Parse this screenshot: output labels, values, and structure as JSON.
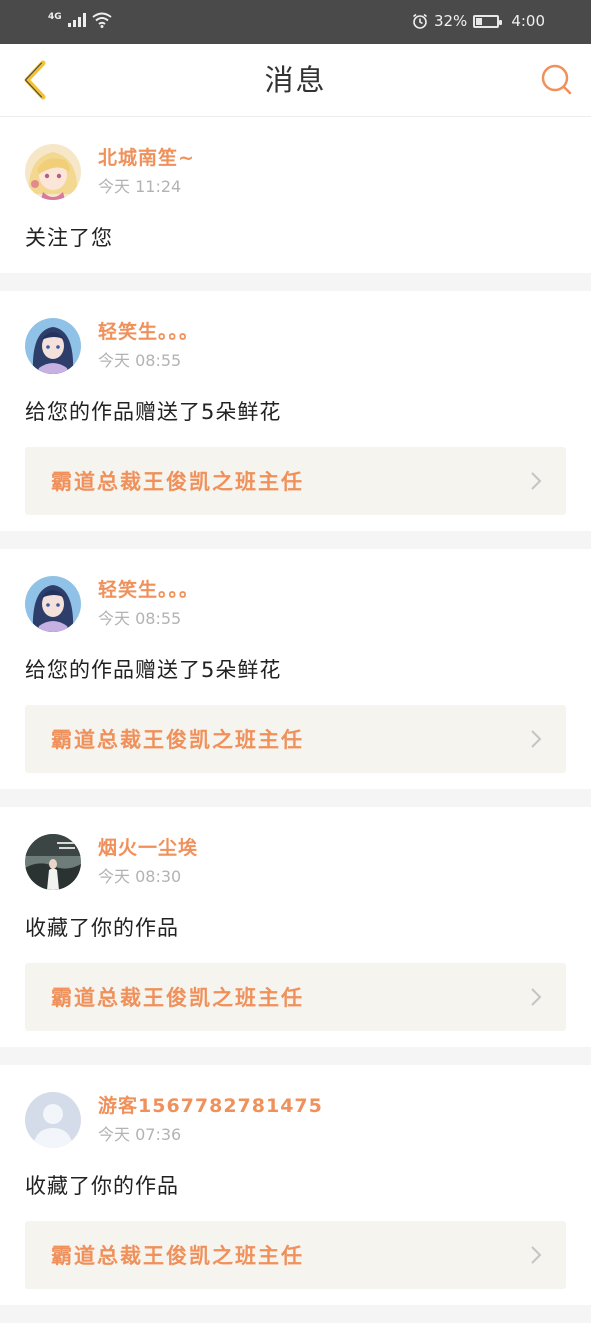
{
  "status_bar": {
    "network": "4G",
    "battery_percent": "32%",
    "battery_level": 0.32,
    "time": "4:00"
  },
  "nav": {
    "title": "消息"
  },
  "colors": {
    "accent": "#f0905a",
    "back_icon": "#f3c335",
    "work_bg": "#f5f4ef"
  },
  "messages": [
    {
      "username": "北城南笙~",
      "time": "今天 11:24",
      "action": "关注了您",
      "avatar": "anime-girl-blonde-avatar"
    },
    {
      "username": "轻笑生。。。",
      "time": "今天 08:55",
      "action": "给您的作品赠送了5朵鲜花",
      "work_title": "霸道总裁王俊凯之班主任",
      "avatar": "anime-girl-blue-avatar"
    },
    {
      "username": "轻笑生。。。",
      "time": "今天 08:55",
      "action": "给您的作品赠送了5朵鲜花",
      "work_title": "霸道总裁王俊凯之班主任",
      "avatar": "anime-girl-blue-avatar"
    },
    {
      "username": "烟火一尘埃",
      "time": "今天 08:30",
      "action": "收藏了你的作品",
      "work_title": "霸道总裁王俊凯之班主任",
      "avatar": "photo-avatar"
    },
    {
      "username": "游客1567782781475",
      "time": "今天 07:36",
      "action": "收藏了你的作品",
      "work_title": "霸道总裁王俊凯之班主任",
      "avatar": "default-user-avatar"
    }
  ]
}
